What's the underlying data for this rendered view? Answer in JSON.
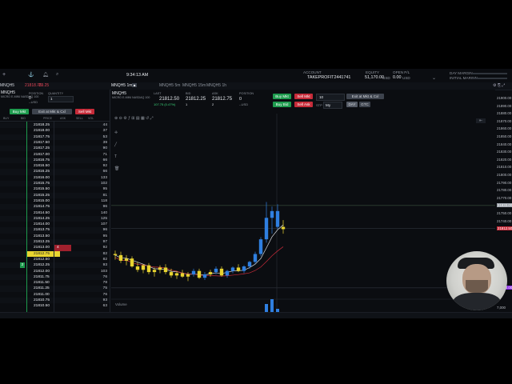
{
  "header": {
    "time": "9:34:13 AM",
    "account_label": "ACCOUNT",
    "account": "TAKEPROFIT2441741",
    "equity_label": "EQUITY",
    "equity": "51,170.00",
    "equity_ccy": "USD",
    "open_pl_label": "OPEN P/L",
    "open_pl": "0.00",
    "open_pl_ccy": "USD",
    "day_margin": "DAY MARGIN",
    "initial_margin": "INITIAL MARGIN",
    "left_price": "21818.76",
    "left_change": "-0.24%",
    "left_delta": "-29.25"
  },
  "tabs": [
    "MNQH5 1m",
    "MNQH5 5m",
    "MNQH5 15m",
    "MNQH5 1h"
  ],
  "ladder": {
    "symbol": "MNQH5",
    "subtitle": "MICRO E-MINI NASDAQ 100",
    "position_label": "POSITION",
    "position": "0",
    "quantity_label": "QUANTITY",
    "quantity": "1",
    "usd": "--USD",
    "buy_mkt": "Buy Mkt",
    "exit_all": "Exit at Mkt & Cxl",
    "sell_mkt": "Sell Mkt",
    "columns": [
      "BUY",
      "BID",
      "PRICE",
      "ASK",
      "SELL",
      "VOL"
    ],
    "rows": [
      {
        "price": "21818.25",
        "ask": "",
        "vol": "44",
        "hl": ""
      },
      {
        "price": "21818.00",
        "ask": "",
        "vol": "37",
        "hl": ""
      },
      {
        "price": "21817.75",
        "ask": "",
        "vol": "53",
        "hl": ""
      },
      {
        "price": "21817.50",
        "ask": "",
        "vol": "39",
        "hl": ""
      },
      {
        "price": "21817.25",
        "ask": "",
        "vol": "90",
        "hl": ""
      },
      {
        "price": "21817.00",
        "ask": "",
        "vol": "71",
        "hl": ""
      },
      {
        "price": "21816.75",
        "ask": "",
        "vol": "66",
        "hl": ""
      },
      {
        "price": "21816.50",
        "ask": "",
        "vol": "92",
        "hl": ""
      },
      {
        "price": "21816.25",
        "ask": "",
        "vol": "66",
        "hl": ""
      },
      {
        "price": "21816.00",
        "ask": "",
        "vol": "133",
        "hl": ""
      },
      {
        "price": "21815.75",
        "ask": "",
        "vol": "102",
        "hl": ""
      },
      {
        "price": "21815.50",
        "ask": "",
        "vol": "95",
        "hl": ""
      },
      {
        "price": "21815.25",
        "ask": "",
        "vol": "81",
        "hl": ""
      },
      {
        "price": "21815.00",
        "ask": "",
        "vol": "118",
        "hl": ""
      },
      {
        "price": "21814.75",
        "ask": "",
        "vol": "96",
        "hl": ""
      },
      {
        "price": "21814.50",
        "ask": "",
        "vol": "140",
        "hl": ""
      },
      {
        "price": "21814.25",
        "ask": "",
        "vol": "125",
        "hl": ""
      },
      {
        "price": "21814.00",
        "ask": "",
        "vol": "107",
        "hl": ""
      },
      {
        "price": "21813.75",
        "ask": "",
        "vol": "96",
        "hl": ""
      },
      {
        "price": "21813.50",
        "ask": "",
        "vol": "95",
        "hl": ""
      },
      {
        "price": "21813.25",
        "ask": "",
        "vol": "97",
        "hl": ""
      },
      {
        "price": "21813.00",
        "ask": "4",
        "vol": "92",
        "hl": "ask"
      },
      {
        "price": "21812.75",
        "ask": "",
        "vol": "82",
        "hl": "yellow"
      },
      {
        "price": "21812.50",
        "ask": "",
        "vol": "82",
        "hl": ""
      },
      {
        "price": "21812.25",
        "ask": "",
        "vol": "93",
        "hl": "green2"
      },
      {
        "price": "21812.00",
        "ask": "",
        "vol": "103",
        "hl": ""
      },
      {
        "price": "21811.75",
        "ask": "",
        "vol": "76",
        "hl": ""
      },
      {
        "price": "21811.50",
        "ask": "",
        "vol": "78",
        "hl": ""
      },
      {
        "price": "21811.25",
        "ask": "",
        "vol": "75",
        "hl": ""
      },
      {
        "price": "21811.00",
        "ask": "",
        "vol": "76",
        "hl": ""
      },
      {
        "price": "21810.75",
        "ask": "",
        "vol": "93",
        "hl": ""
      },
      {
        "price": "21810.50",
        "ask": "",
        "vol": "63",
        "hl": ""
      }
    ],
    "bid_qty_green": "2"
  },
  "quote": {
    "symbol": "MNQH5",
    "subtitle": "MICRO E-MINI NASDAQ 100",
    "last_label": "LAST",
    "last": "21812.50",
    "change": "107.75 (0.47%)",
    "bid_label": "BID",
    "bid": "21812.25",
    "bid_size": "1",
    "ask_label": "ASK",
    "ask": "21812.75",
    "ask_size": "2",
    "position_label": "POSITION",
    "position": "0",
    "usd": "--USD",
    "buy_mkt": "Buy Mkt",
    "sell_mkt": "Sell Mkt",
    "qty": "10",
    "exit_all": "Exit at Mkt & Cxl",
    "buy_bid": "Buy Bid",
    "sell_ask": "Sell Ask",
    "tif": "My",
    "day": "DAY",
    "gtc": "GTC",
    "stp": "STP"
  },
  "chart_data": {
    "type": "candlestick",
    "title": "",
    "ylabel": "",
    "ylim": [
      21750,
      21910
    ],
    "yticks": [
      "21900.00",
      "21890.00",
      "21880.00",
      "21870.00",
      "21860.00",
      "21850.00",
      "21840.00",
      "21830.00",
      "21820.00",
      "21810.00",
      "21800.00",
      "21790.00",
      "21780.00",
      "21770.00",
      "21760.00",
      "21750.00",
      "21740.00"
    ],
    "price_tags": [
      {
        "label": "21833.00",
        "color": "#9aa0a8"
      },
      {
        "label": "21812.50",
        "color": "#c62b39"
      },
      {
        "label": "21760.00",
        "color": "#8a2be2"
      }
    ],
    "candles": [
      [
        21790,
        21793,
        21785,
        21789,
        "y"
      ],
      [
        21789,
        21792,
        21782,
        21784,
        "y"
      ],
      [
        21784,
        21789,
        21780,
        21786,
        "y"
      ],
      [
        21786,
        21788,
        21778,
        21779,
        "y"
      ],
      [
        21779,
        21783,
        21774,
        21776,
        "y"
      ],
      [
        21776,
        21781,
        21773,
        21780,
        "y"
      ],
      [
        21780,
        21782,
        21772,
        21774,
        "y"
      ],
      [
        21774,
        21778,
        21770,
        21776,
        "y"
      ],
      [
        21776,
        21780,
        21773,
        21778,
        "y"
      ],
      [
        21778,
        21781,
        21772,
        21774,
        "y"
      ],
      [
        21774,
        21777,
        21769,
        21771,
        "y"
      ],
      [
        21771,
        21775,
        21768,
        21773,
        "y"
      ],
      [
        21773,
        21776,
        21769,
        21770,
        "y"
      ],
      [
        21770,
        21774,
        21766,
        21772,
        "y"
      ],
      [
        21772,
        21777,
        21770,
        21775,
        "b"
      ],
      [
        21775,
        21777,
        21768,
        21769,
        "y"
      ],
      [
        21769,
        21774,
        21767,
        21772,
        "b"
      ],
      [
        21772,
        21776,
        21770,
        21774,
        "y"
      ],
      [
        21774,
        21779,
        21772,
        21777,
        "b"
      ],
      [
        21777,
        21779,
        21770,
        21771,
        "y"
      ],
      [
        21771,
        21776,
        21769,
        21775,
        "b"
      ],
      [
        21775,
        21779,
        21773,
        21778,
        "b"
      ],
      [
        21778,
        21781,
        21774,
        21775,
        "y"
      ],
      [
        21775,
        21780,
        21773,
        21779,
        "b"
      ],
      [
        21779,
        21784,
        21777,
        21783,
        "b"
      ],
      [
        21783,
        21792,
        21781,
        21790,
        "b"
      ],
      [
        21790,
        21805,
        21788,
        21803,
        "b"
      ],
      [
        21803,
        21836,
        21800,
        21822,
        "b"
      ],
      [
        21822,
        21832,
        21808,
        21828,
        "b"
      ],
      [
        21828,
        21834,
        21812,
        21814,
        "b"
      ],
      [
        21814,
        21820,
        21808,
        21812,
        "y"
      ]
    ],
    "volume": [
      0,
      0,
      0,
      0,
      0,
      0,
      0,
      0,
      0,
      0,
      0,
      0,
      0,
      0,
      0,
      0,
      0,
      0,
      0,
      0,
      0,
      0,
      0,
      0,
      0,
      0,
      4,
      9,
      12,
      6,
      3
    ],
    "volume_label": "Volume",
    "vol_axis": "7,000"
  }
}
